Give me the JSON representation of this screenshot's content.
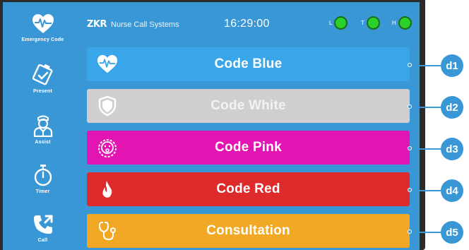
{
  "sidebar": {
    "items": [
      {
        "label": "Emergency Code",
        "icon": "heart-pulse-icon"
      },
      {
        "label": "Present",
        "icon": "badge-check-icon"
      },
      {
        "label": "Assist",
        "icon": "nurse-icon"
      },
      {
        "label": "Timer",
        "icon": "stopwatch-icon"
      },
      {
        "label": "Call",
        "icon": "phone-call-icon"
      }
    ]
  },
  "header": {
    "brand": "ZKR",
    "subtitle": "Nurse Call Systems",
    "clock": "16:29:00",
    "indicators": [
      {
        "letter": "L",
        "color": "#29d12a"
      },
      {
        "letter": "T",
        "color": "#29d12a"
      },
      {
        "letter": "H",
        "color": "#29d12a"
      }
    ]
  },
  "codes": [
    {
      "label": "Code Blue",
      "color": "#3aa6ea",
      "text_color": "#ffffff",
      "icon": "heart-pulse-icon"
    },
    {
      "label": "Code White",
      "color": "#cfcfcf",
      "text_color": "#f2f2f2",
      "icon": "shield-icon"
    },
    {
      "label": "Code Pink",
      "color": "#e215b3",
      "text_color": "#ffffff",
      "icon": "baby-face-icon"
    },
    {
      "label": "Code Red",
      "color": "#de2a2b",
      "text_color": "#ffffff",
      "icon": "flame-icon"
    },
    {
      "label": "Consultation",
      "color": "#f1a824",
      "text_color": "#ffffff",
      "icon": "stethoscope-icon"
    }
  ],
  "callouts": [
    "d1",
    "d2",
    "d3",
    "d4",
    "d5"
  ]
}
